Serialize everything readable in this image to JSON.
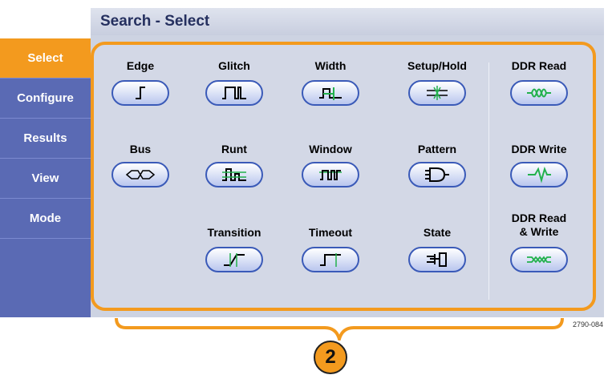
{
  "header": {
    "title": "Search - Select"
  },
  "sidebar": {
    "items": [
      {
        "label": "Select",
        "active": true
      },
      {
        "label": "Configure",
        "active": false
      },
      {
        "label": "Results",
        "active": false
      },
      {
        "label": "View",
        "active": false
      },
      {
        "label": "Mode",
        "active": false
      }
    ]
  },
  "search_types": {
    "edge": "Edge",
    "glitch": "Glitch",
    "width": "Width",
    "setup_hold": "Setup/Hold",
    "ddr_read": "DDR Read",
    "bus": "Bus",
    "runt": "Runt",
    "window": "Window",
    "pattern": "Pattern",
    "ddr_write": "DDR Write",
    "transition": "Transition",
    "timeout": "Timeout",
    "state": "State",
    "ddr_read_write": "DDR Read\n& Write"
  },
  "callout": {
    "number": "2"
  },
  "figure_id": "2790-084",
  "colors": {
    "accent": "#f39a1e",
    "sidebar": "#5a6ab4",
    "panel": "#cdd3e2",
    "button_border": "#3a5ab8",
    "trace_green": "#22b14c"
  }
}
